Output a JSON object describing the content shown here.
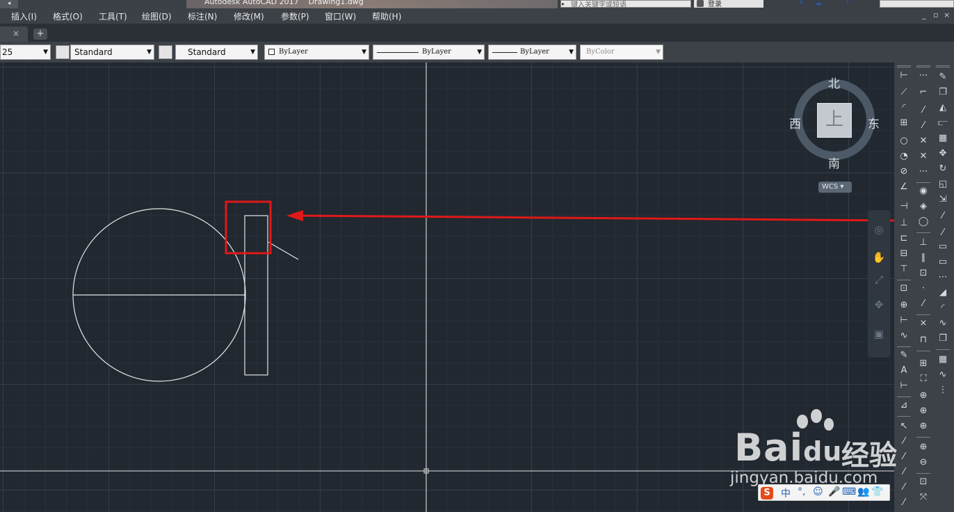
{
  "titlebar": {
    "app_title": "Autodesk AutoCAD 2017    Drawing1.dwg",
    "search_placeholder": "键入关键字或短语",
    "login_label": "登录"
  },
  "menu": {
    "items": [
      "插入(I)",
      "格式(O)",
      "工具(T)",
      "绘图(D)",
      "标注(N)",
      "修改(M)",
      "参数(P)",
      "窗口(W)",
      "帮助(H)"
    ],
    "doc_controls": [
      "_",
      "▫",
      "×"
    ]
  },
  "tabs": {
    "close_glyph": "×",
    "add_glyph": "+"
  },
  "properties": {
    "layer_value": "25",
    "text_style": "Standard",
    "dim_style": "Standard",
    "color": "ByLayer",
    "linetype": "ByLayer",
    "lineweight": "ByLayer",
    "plot_style": "ByColor"
  },
  "viewcube": {
    "north": "北",
    "south": "南",
    "east": "东",
    "west": "西",
    "face": "上",
    "wcs_label": "WCS"
  },
  "watermark": {
    "brand": "Bai",
    "brand_du": "du",
    "brand_cn": "经验",
    "url": "jingyan.baidu.com"
  },
  "ime": {
    "logo": "S",
    "mode": "中",
    "items": [
      "°,",
      "☺",
      "🎤",
      "⌨",
      "👥",
      "👕",
      "⠿"
    ]
  },
  "colors": {
    "canvas": "#212830",
    "highlight": "#e01818",
    "geometry": "#e6e6e6"
  }
}
